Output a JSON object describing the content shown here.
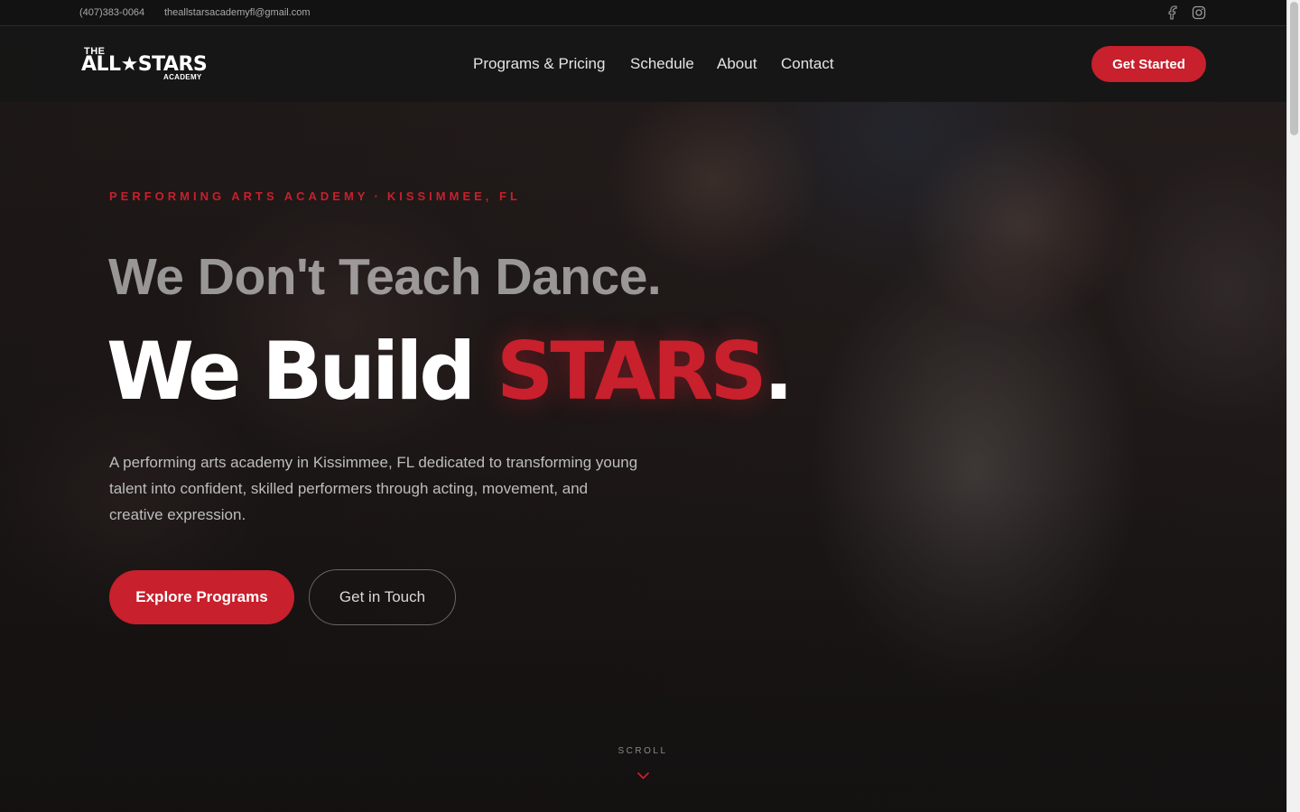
{
  "topbar": {
    "phone": "(407)383-0064",
    "email": "theallstarsacademyfl@gmail.com",
    "social_icons": [
      "facebook-icon",
      "instagram-icon"
    ]
  },
  "logo": {
    "the": "THE",
    "main": "ALL★STARS",
    "academy": "ACADEMY"
  },
  "nav": {
    "links": [
      "Programs & Pricing",
      "Schedule",
      "About",
      "Contact"
    ],
    "cta": "Get Started"
  },
  "hero": {
    "eyebrow_left": "PERFORMING ARTS ACADEMY",
    "eyebrow_sep": "·",
    "eyebrow_right": "KISSIMMEE, FL",
    "headline_1": "We Don't Teach Dance.",
    "headline_2_start": "We Build ",
    "headline_2_accent": "STARS",
    "headline_2_end": ".",
    "description": "A performing arts academy in Kissimmee, FL dedicated to transforming young talent into confident, skilled performers through acting, movement, and creative expression.",
    "primary_button": "Explore Programs",
    "secondary_button": "Get in Touch",
    "scroll_label": "SCROLL"
  },
  "colors": {
    "accent": "#c8202c",
    "background": "#141414",
    "topbar": "#121212"
  }
}
